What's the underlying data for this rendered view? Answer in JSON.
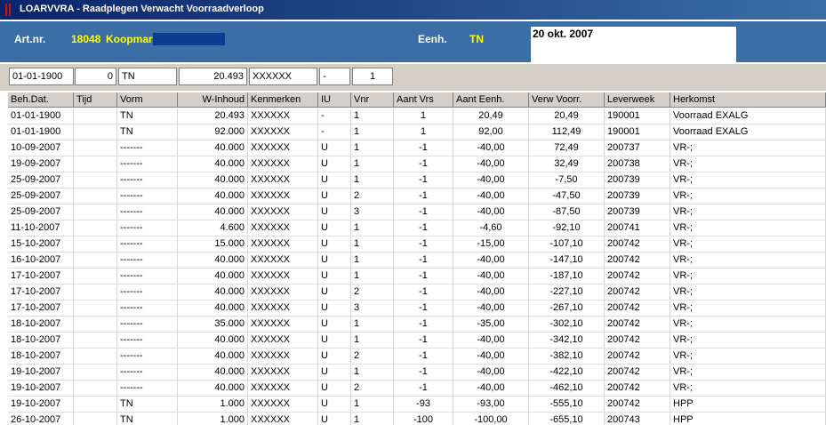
{
  "window": {
    "title": "LOARVVRA - Raadplegen Verwacht Voorraadverloop"
  },
  "header": {
    "artnr_label": "Art.nr.",
    "artnr_value": "18048",
    "artname_value": "Koopmar",
    "eenh_label": "Eenh.",
    "eenh_value": "TN",
    "date": "20 okt. 2007"
  },
  "filters": {
    "date": "01-01-1900",
    "num": "0",
    "vorm": "TN",
    "inhoud": "20.493",
    "kenmerken": "XXXXXX",
    "iu": "-",
    "vnr": "1"
  },
  "table": {
    "columns": [
      "Beh.Dat.",
      "Tijd",
      "Vorm",
      "W-Inhoud",
      "Kenmerken",
      "IU",
      "Vnr",
      "Aant Vrs",
      "Aant Eenh.",
      "Verw Voorr.",
      "Leverweek",
      "Herkomst"
    ],
    "rows": [
      [
        "01-01-1900",
        "",
        "TN",
        "20.493",
        "XXXXXX",
        "-",
        "1",
        "1",
        "20,49",
        "20,49",
        "190001",
        "Voorraad EXALG"
      ],
      [
        "01-01-1900",
        "",
        "TN",
        "92.000",
        "XXXXXX",
        "-",
        "1",
        "1",
        "92,00",
        "112,49",
        "190001",
        "Voorraad EXALG"
      ],
      [
        "10-09-2007",
        "",
        "-------",
        "40.000",
        "XXXXXX",
        "U",
        "1",
        "-1",
        "-40,00",
        "72,49",
        "200737",
        "VR-;"
      ],
      [
        "19-09-2007",
        "",
        "-------",
        "40.000",
        "XXXXXX",
        "U",
        "1",
        "-1",
        "-40,00",
        "32,49",
        "200738",
        "VR-;"
      ],
      [
        "25-09-2007",
        "",
        "-------",
        "40.000",
        "XXXXXX",
        "U",
        "1",
        "-1",
        "-40,00",
        "-7,50",
        "200739",
        "VR-;"
      ],
      [
        "25-09-2007",
        "",
        "-------",
        "40.000",
        "XXXXXX",
        "U",
        "2",
        "-1",
        "-40,00",
        "-47,50",
        "200739",
        "VR-;"
      ],
      [
        "25-09-2007",
        "",
        "-------",
        "40.000",
        "XXXXXX",
        "U",
        "3",
        "-1",
        "-40,00",
        "-87,50",
        "200739",
        "VR-;"
      ],
      [
        "11-10-2007",
        "",
        "-------",
        "4.600",
        "XXXXXX",
        "U",
        "1",
        "-1",
        "-4,60",
        "-92,10",
        "200741",
        "VR-;"
      ],
      [
        "15-10-2007",
        "",
        "-------",
        "15.000",
        "XXXXXX",
        "U",
        "1",
        "-1",
        "-15,00",
        "-107,10",
        "200742",
        "VR-;"
      ],
      [
        "16-10-2007",
        "",
        "-------",
        "40.000",
        "XXXXXX",
        "U",
        "1",
        "-1",
        "-40,00",
        "-147,10",
        "200742",
        "VR-;"
      ],
      [
        "17-10-2007",
        "",
        "-------",
        "40.000",
        "XXXXXX",
        "U",
        "1",
        "-1",
        "-40,00",
        "-187,10",
        "200742",
        "VR-;"
      ],
      [
        "17-10-2007",
        "",
        "-------",
        "40.000",
        "XXXXXX",
        "U",
        "2",
        "-1",
        "-40,00",
        "-227,10",
        "200742",
        "VR-;"
      ],
      [
        "17-10-2007",
        "",
        "-------",
        "40.000",
        "XXXXXX",
        "U",
        "3",
        "-1",
        "-40,00",
        "-267,10",
        "200742",
        "VR-;"
      ],
      [
        "18-10-2007",
        "",
        "-------",
        "35.000",
        "XXXXXX",
        "U",
        "1",
        "-1",
        "-35,00",
        "-302,10",
        "200742",
        "VR-;"
      ],
      [
        "18-10-2007",
        "",
        "-------",
        "40.000",
        "XXXXXX",
        "U",
        "1",
        "-1",
        "-40,00",
        "-342,10",
        "200742",
        "VR-;"
      ],
      [
        "18-10-2007",
        "",
        "-------",
        "40.000",
        "XXXXXX",
        "U",
        "2",
        "-1",
        "-40,00",
        "-382,10",
        "200742",
        "VR-;"
      ],
      [
        "19-10-2007",
        "",
        "-------",
        "40.000",
        "XXXXXX",
        "U",
        "1",
        "-1",
        "-40,00",
        "-422,10",
        "200742",
        "VR-;"
      ],
      [
        "19-10-2007",
        "",
        "-------",
        "40.000",
        "XXXXXX",
        "U",
        "2",
        "-1",
        "-40,00",
        "-462,10",
        "200742",
        "VR-;"
      ],
      [
        "19-10-2007",
        "",
        "TN",
        "1.000",
        "XXXXXX",
        "U",
        "1",
        "-93",
        "-93,00",
        "-555,10",
        "200742",
        "HPP"
      ],
      [
        "26-10-2007",
        "",
        "TN",
        "1.000",
        "XXXXXX",
        "U",
        "1",
        "-100",
        "-100,00",
        "-655,10",
        "200743",
        "HPP"
      ]
    ]
  }
}
